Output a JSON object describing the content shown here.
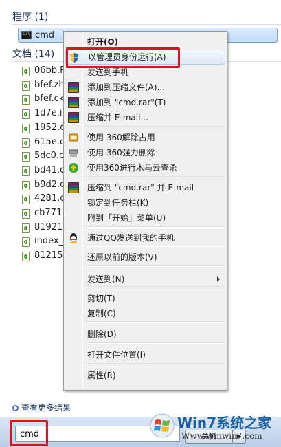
{
  "programs": {
    "header": "程序 (1)",
    "items": [
      {
        "label": "cmd",
        "icon": "cmd-icon"
      }
    ]
  },
  "documents": {
    "header": "文档 (14)",
    "items": [
      {
        "label": "06bb.R"
      },
      {
        "label": "bfef.zh"
      },
      {
        "label": "bfef.ck"
      },
      {
        "label": "1d7e.in"
      },
      {
        "label": "1952.cc"
      },
      {
        "label": "615e.cc"
      },
      {
        "label": "5dc0.cc"
      },
      {
        "label": "bd41.c"
      },
      {
        "label": "b9d2.c"
      },
      {
        "label": "4281.cl"
      },
      {
        "label": "cb771e"
      },
      {
        "label": "819216"
      },
      {
        "label": "index_a"
      },
      {
        "label": "812156"
      }
    ]
  },
  "see_more": "查看更多结果",
  "search": {
    "value": "cmd"
  },
  "shutdown": {
    "label": "关机",
    "arrow": "▶"
  },
  "watermark": {
    "title": "Win7系统之家",
    "url": "Www.Winwin7.com"
  },
  "context_menu": {
    "items": [
      {
        "label": "打开(O)",
        "bold": true
      },
      {
        "label": "以管理员身份运行(A)",
        "icon": "uac-shield-icon",
        "hover": true
      },
      {
        "label": "发送到手机"
      },
      {
        "label": "添加到压缩文件(A)...",
        "icon": "winrar-icon"
      },
      {
        "label": "添加到 \"cmd.rar\"(T)",
        "icon": "winrar-icon"
      },
      {
        "label": "压缩并 E-mail...",
        "icon": "winrar-icon"
      },
      {
        "label": "使用 360解除占用",
        "icon": "360-unlock-icon"
      },
      {
        "label": "使用 360强力删除",
        "icon": "360-shred-icon"
      },
      {
        "label": "使用360进行木马云查杀",
        "icon": "360-scan-icon"
      },
      {
        "label": "压缩到 \"cmd.rar\" 并 E-mail",
        "icon": "winrar-icon"
      },
      {
        "label": "锁定到任务栏(K)"
      },
      {
        "label": "附到「开始」菜单(U)"
      },
      {
        "label": "通过QQ发送到我的手机",
        "icon": "qq-icon"
      },
      {
        "label": "还原以前的版本(V)"
      },
      {
        "label": "发送到(N)",
        "submenu": true
      },
      {
        "label": "剪切(T)"
      },
      {
        "label": "复制(C)"
      },
      {
        "label": "删除(D)"
      },
      {
        "label": "打开文件位置(I)"
      },
      {
        "label": "属性(R)"
      }
    ]
  },
  "colors": {
    "highlight_border": "#e0141c",
    "menu_hover": "#dde9f8",
    "section_header": "#1e395b"
  }
}
